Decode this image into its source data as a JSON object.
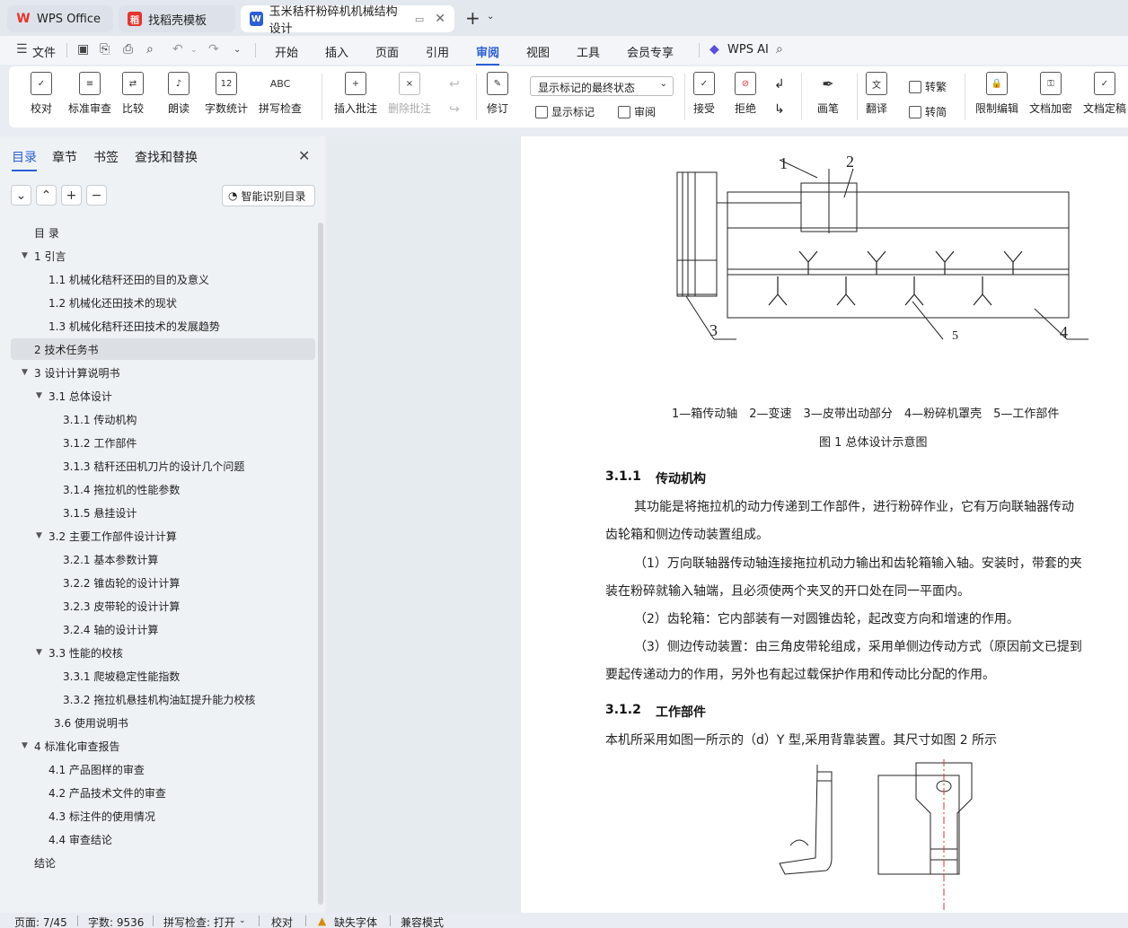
{
  "tabs": [
    {
      "label": "WPS Office",
      "icon": "wps-logo-icon",
      "color": "#e8332a"
    },
    {
      "label": "找稻壳模板",
      "icon": "docer-icon",
      "color": "#e8332a"
    },
    {
      "label": "玉米秸秆粉碎机机械结构设计",
      "icon": "word-doc-icon",
      "color": "#2a5fd6"
    }
  ],
  "menu": {
    "file": "文件",
    "items": [
      "开始",
      "插入",
      "页面",
      "引用",
      "审阅",
      "视图",
      "工具",
      "会员专享"
    ],
    "active": "审阅",
    "ai": "WPS AI"
  },
  "ribbon": {
    "proof": "校对",
    "standard_review": "标准审查",
    "compare": "比较",
    "read_aloud": "朗读",
    "word_count": "字数统计",
    "spell_check": "拼写检查",
    "insert_comment": "插入批注",
    "delete_comment": "删除批注",
    "revise": "修订",
    "markup_state": "显示标记的最终状态",
    "show_markup": "显示标记",
    "review": "审阅",
    "accept": "接受",
    "reject": "拒绝",
    "pen": "画笔",
    "translate": "翻译",
    "to_traditional": "转繁",
    "to_simplified": "转简",
    "restrict_edit": "限制编辑",
    "encrypt": "文档加密",
    "finalize": "文档定稿"
  },
  "sidebar": {
    "tabs": [
      "目录",
      "章节",
      "书签",
      "查找和替换"
    ],
    "smart_toc": "智能识别目录",
    "toc": [
      {
        "label": "目  录",
        "level": 0,
        "tri": false
      },
      {
        "label": "1  引言",
        "level": 0,
        "tri": true
      },
      {
        "label": "1.1  机械化秸秆还田的目的及意义",
        "level": 1,
        "tri": false
      },
      {
        "label": "1.2  机械化还田技术的现状",
        "level": 1,
        "tri": false
      },
      {
        "label": "1.3  机械化秸秆还田技术的发展趋势",
        "level": 1,
        "tri": false
      },
      {
        "label": "2  技术任务书",
        "level": 0,
        "tri": false,
        "selected": true
      },
      {
        "label": "3  设计计算说明书",
        "level": 0,
        "tri": true
      },
      {
        "label": "3.1  总体设计",
        "level": 1,
        "tri": true
      },
      {
        "label": "3.1.1  传动机构",
        "level": 2,
        "tri": false
      },
      {
        "label": "3.1.2  工作部件",
        "level": 2,
        "tri": false
      },
      {
        "label": "3.1.3  秸秆还田机刀片的设计几个问题",
        "level": 2,
        "tri": false
      },
      {
        "label": "3.1.4  拖拉机的性能参数",
        "level": 2,
        "tri": false
      },
      {
        "label": "3.1.5  悬挂设计",
        "level": 2,
        "tri": false
      },
      {
        "label": "3.2  主要工作部件设计计算",
        "level": 1,
        "tri": true
      },
      {
        "label": "3.2.1  基本参数计算",
        "level": 2,
        "tri": false
      },
      {
        "label": "3.2.2  锥齿轮的设计计算",
        "level": 2,
        "tri": false
      },
      {
        "label": "3.2.3  皮带轮的设计计算",
        "level": 2,
        "tri": false
      },
      {
        "label": "3.2.4  轴的设计计算",
        "level": 2,
        "tri": false
      },
      {
        "label": "3.3  性能的校核",
        "level": 1,
        "tri": true
      },
      {
        "label": "3.3.1  爬坡稳定性能指数",
        "level": 2,
        "tri": false
      },
      {
        "label": "3.3.2  拖拉机悬挂机构油缸提升能力校核",
        "level": 2,
        "tri": false
      },
      {
        "label": "3.6  使用说明书",
        "level": 1.5,
        "tri": false
      },
      {
        "label": "4  标准化审查报告",
        "level": 0,
        "tri": true
      },
      {
        "label": "4.1  产品图样的审查",
        "level": 1,
        "tri": false
      },
      {
        "label": "4.2  产品技术文件的审查",
        "level": 1,
        "tri": false
      },
      {
        "label": "4.3  标注件的使用情况",
        "level": 1,
        "tri": false
      },
      {
        "label": "4.4  审查结论",
        "level": 1,
        "tri": false
      },
      {
        "label": "结论",
        "level": 0,
        "tri": false
      }
    ]
  },
  "document": {
    "fig1_labels": [
      "1",
      "2",
      "3",
      "4",
      "5"
    ],
    "fig1_legend": "1—箱传动轴　2—变速　3—皮带出动部分　4—粉碎机罩壳　5—工作部件",
    "fig1_caption": "图 1  总体设计示意图",
    "h311_num": "3.1.1",
    "h311_title": "传动机构",
    "p1a": "其功能是将拖拉机的动力传递到工作部件，进行粉碎作业，它有万向联轴器传动",
    "p1b": "齿轮箱和侧边传动装置组成。",
    "p2a": "（1）万向联轴器传动轴连接拖拉机动力输出和齿轮箱输入轴。安装时，带套的夹",
    "p2b": "装在粉碎就输入轴端，且必须使两个夹叉的开口处在同一平面内。",
    "p3": "（2）齿轮箱：它内部装有一对圆锥齿轮，起改变方向和增速的作用。",
    "p4a": "（3）侧边传动装置：由三角皮带轮组成，采用单侧边传动方式（原因前文已提到",
    "p4b": "要起传递动力的作用，另外也有起过载保护作用和传动比分配的作用。",
    "h312_num": "3.1.2",
    "h312_title": "工作部件",
    "p5": "本机所采用如图一所示的（d）Y 型,采用背靠装置。其尺寸如图 2 所示"
  },
  "status": {
    "page": "页面: 7/45",
    "words": "字数: 9536",
    "spell": "拼写检查: 打开",
    "proof": "校对",
    "missing_font": "缺失字体",
    "compat": "兼容模式"
  }
}
